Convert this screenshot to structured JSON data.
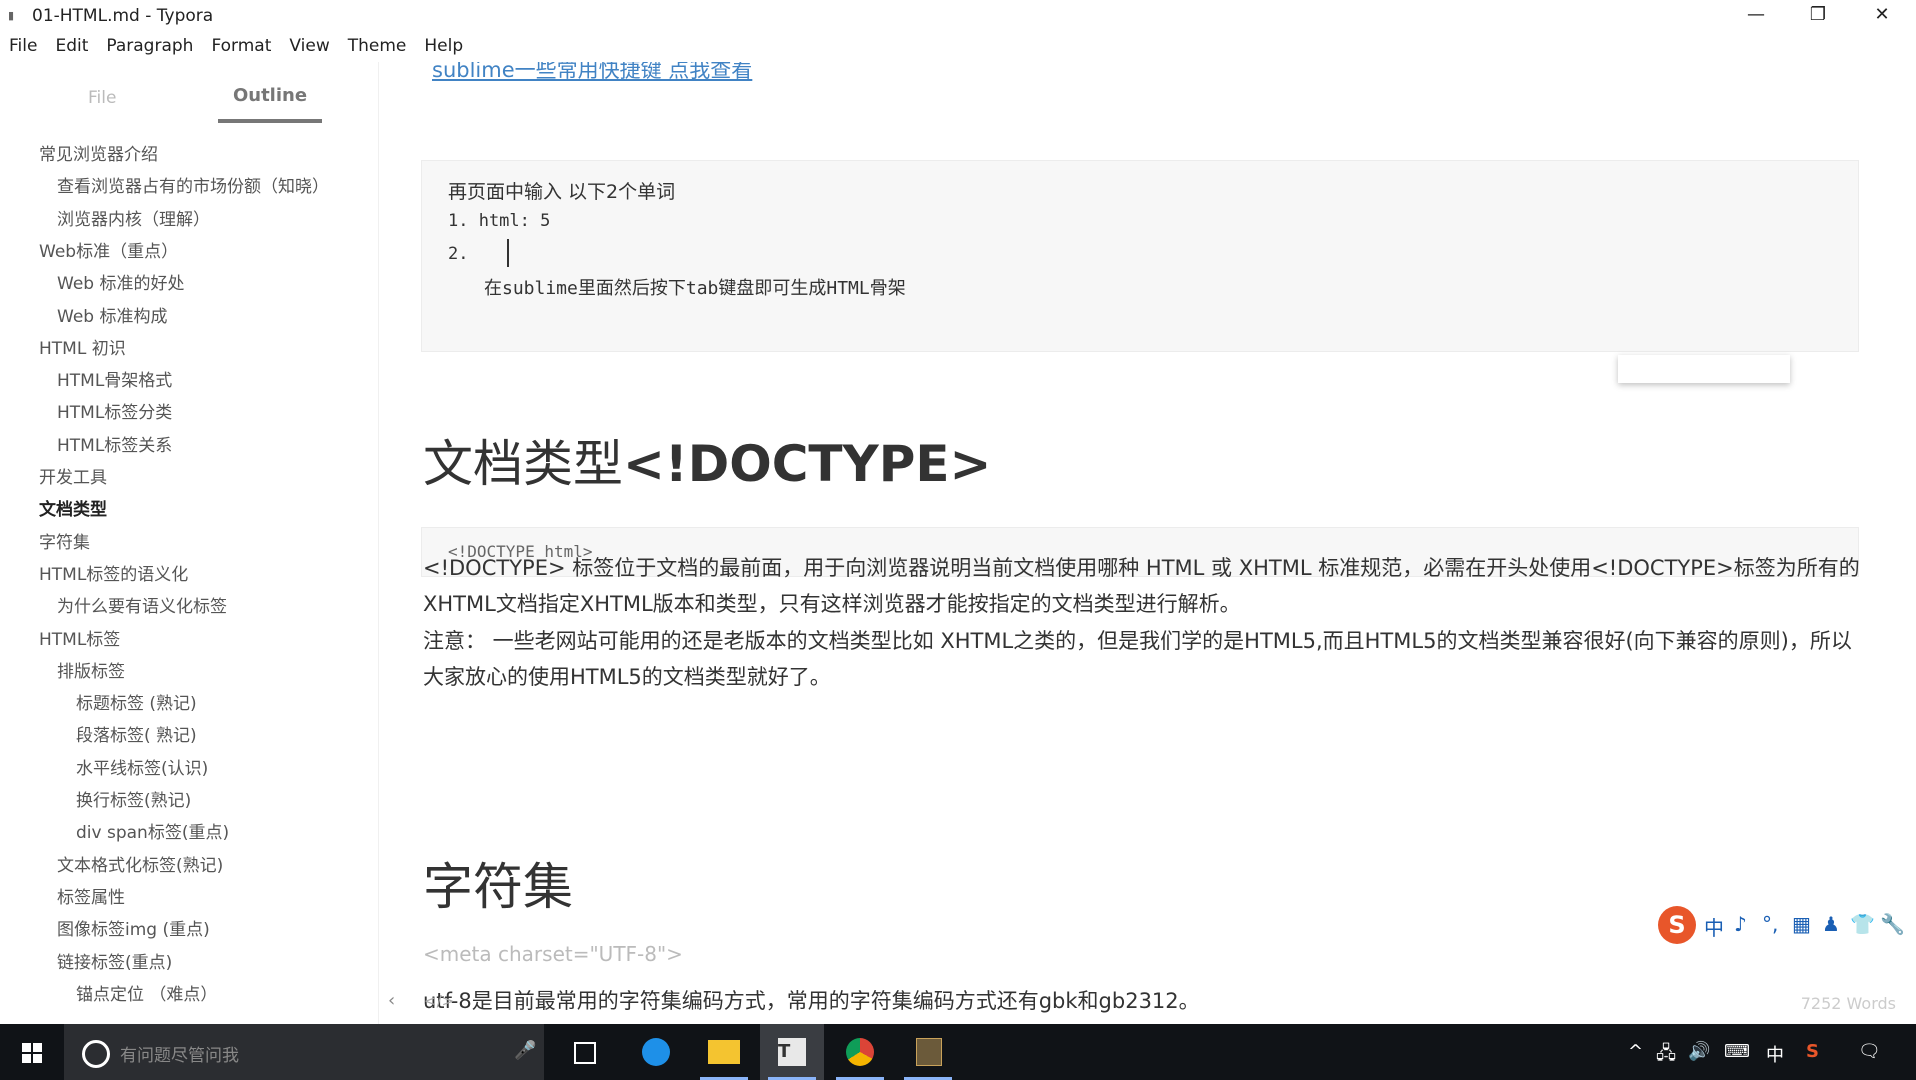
{
  "window": {
    "title": "01-HTML.md - Typora",
    "minimize": "—",
    "maximize": "❐",
    "close": "✕"
  },
  "menu": [
    "File",
    "Edit",
    "Paragraph",
    "Format",
    "View",
    "Theme",
    "Help"
  ],
  "sidebar": {
    "tab_file": "File",
    "tab_outline": "Outline",
    "outline": [
      {
        "label": "常见浏览器介绍",
        "level": 1
      },
      {
        "label": "查看浏览器占有的市场份额（知晓）",
        "level": 2
      },
      {
        "label": "浏览器内核（理解）",
        "level": 2
      },
      {
        "label": "Web标准（重点）",
        "level": 1
      },
      {
        "label": "Web 标准的好处",
        "level": 2
      },
      {
        "label": "Web 标准构成",
        "level": 2
      },
      {
        "label": "HTML 初识",
        "level": 1
      },
      {
        "label": "HTML骨架格式",
        "level": 2
      },
      {
        "label": "HTML标签分类",
        "level": 2
      },
      {
        "label": "HTML标签关系",
        "level": 2
      },
      {
        "label": "开发工具",
        "level": 1
      },
      {
        "label": "文档类型",
        "level": 1,
        "active": true
      },
      {
        "label": "字符集",
        "level": 1
      },
      {
        "label": "HTML标签的语义化",
        "level": 1
      },
      {
        "label": "为什么要有语义化标签",
        "level": 2
      },
      {
        "label": "HTML标签",
        "level": 1
      },
      {
        "label": "排版标签",
        "level": 2
      },
      {
        "label": "标题标签 (熟记)",
        "level": 3
      },
      {
        "label": "段落标签( 熟记)",
        "level": 3
      },
      {
        "label": "水平线标签(认识)",
        "level": 3
      },
      {
        "label": "换行标签(熟记)",
        "level": 3
      },
      {
        "label": "div span标签(重点)",
        "level": 3
      },
      {
        "label": "文本格式化标签(熟记)",
        "level": 2
      },
      {
        "label": "标签属性",
        "level": 2
      },
      {
        "label": "图像标签img (重点)",
        "level": 2
      },
      {
        "label": "链接标签(重点)",
        "level": 2
      },
      {
        "label": "锚点定位 （难点）",
        "level": 3
      }
    ],
    "footer_left": "‹",
    "footer_code": "</>"
  },
  "content": {
    "top_link": "sublime一些常用快捷键 点我查看",
    "code1": {
      "line0": "再页面中输入 以下2个单词",
      "line1": "1.  html: 5",
      "line2": "2.",
      "line3": "在sublime里面然后按下tab键盘即可生成HTML骨架"
    },
    "heading_doctype_cn": "文档类型",
    "heading_doctype_latin": "<!DOCTYPE>",
    "code2": "<!DOCTYPE html>",
    "para1": "<!DOCTYPE> 标签位于文档的最前面，用于向浏览器说明当前文档使用哪种 HTML 或 XHTML 标准规范，必需在开头处使用<!DOCTYPE>标签为所有的XHTML文档指定XHTML版本和类型，只有这样浏览器才能按指定的文档类型进行解析。",
    "para2": "注意： 一些老网站可能用的还是老版本的文档类型比如 XHTML之类的，但是我们学的是HTML5,而且HTML5的文档类型兼容很好(向下兼容的原则)，所以大家放心的使用HTML5的文档类型就好了。",
    "heading_charset": "字符集",
    "meta_line": "<meta charset=\"UTF-8\">",
    "utf_line": "utf-8是目前最常用的字符集编码方式，常用的字符集编码方式还有gbk和gb2312。",
    "word_count": "7252 Words"
  },
  "ime": {
    "logo": "S",
    "items": [
      "中",
      "♪",
      "°,",
      "▦",
      "♟",
      "👕",
      "🔧"
    ]
  },
  "taskbar": {
    "search_placeholder": "有问题尽管问我",
    "mic": "🎤",
    "tray": [
      "^",
      "🖧",
      "🔊",
      "⌨",
      "中",
      "S",
      "🗨"
    ]
  }
}
